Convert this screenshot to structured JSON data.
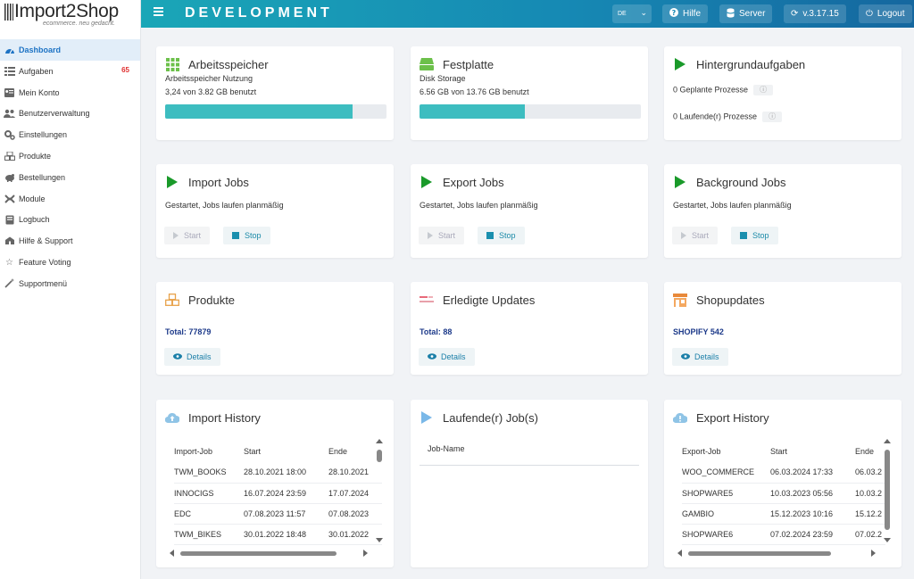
{
  "app": {
    "logo_title": "Import2Shop",
    "logo_subtitle": "ecommerce. neu gedacht.",
    "environment": "DEVELOPMENT"
  },
  "sidebar": {
    "items": [
      {
        "label": "Dashboard",
        "icon": "dashboard-icon",
        "active": true
      },
      {
        "label": "Aufgaben",
        "icon": "tasks-icon",
        "badge": "65"
      },
      {
        "label": "Mein Konto",
        "icon": "account-icon"
      },
      {
        "label": "Benutzerverwaltung",
        "icon": "users-icon"
      },
      {
        "label": "Einstellungen",
        "icon": "settings-icon"
      },
      {
        "label": "Produkte",
        "icon": "products-icon"
      },
      {
        "label": "Bestellungen",
        "icon": "orders-icon"
      },
      {
        "label": "Module",
        "icon": "modules-icon"
      },
      {
        "label": "Logbuch",
        "icon": "logbook-icon"
      },
      {
        "label": "Hilfe & Support",
        "icon": "support-icon"
      },
      {
        "label": "Feature Voting",
        "icon": "star-icon"
      },
      {
        "label": "Supportmenü",
        "icon": "wand-icon"
      }
    ]
  },
  "topbar": {
    "language": "DE",
    "help_label": "Hilfe",
    "server_label": "Server",
    "version_label": "v.3.17.15",
    "logout_label": "Logout"
  },
  "memory": {
    "title": "Arbeitsspeicher",
    "subtitle": "Arbeitsspeicher Nutzung",
    "usage_text": "3,24 von 3.82 GB benutzt",
    "fraction": 0.848
  },
  "disk": {
    "title": "Festplatte",
    "subtitle": "Disk Storage",
    "usage_text": "6.56 GB von 13.76 GB benutzt",
    "fraction": 0.477
  },
  "background_tasks": {
    "title": "Hintergrundaufgaben",
    "planned": "0 Geplante Prozesse",
    "running": "0 Laufende(r) Prozesse"
  },
  "jobs": {
    "status_text": "Gestartet, Jobs laufen planmäßig",
    "start_label": "Start",
    "stop_label": "Stop",
    "import_title": "Import Jobs",
    "export_title": "Export Jobs",
    "background_title": "Background Jobs"
  },
  "products": {
    "title": "Produkte",
    "total": "Total: 77879",
    "details_label": "Details"
  },
  "updates": {
    "title": "Erledigte Updates",
    "total": "Total: 88",
    "details_label": "Details"
  },
  "shopupdates": {
    "title": "Shopupdates",
    "total": "SHOPIFY 542",
    "details_label": "Details"
  },
  "import_history": {
    "title": "Import History",
    "columns": [
      "Import-Job",
      "Start",
      "Ende"
    ],
    "rows": [
      [
        "TWM_BOOKS",
        "28.10.2021 18:00",
        "28.10.2021"
      ],
      [
        "INNOCIGS",
        "16.07.2024 23:59",
        "17.07.2024"
      ],
      [
        "EDC",
        "07.08.2023 11:57",
        "07.08.2023"
      ],
      [
        "TWM_BIKES",
        "30.01.2022 18:48",
        "30.01.2022"
      ]
    ]
  },
  "running_jobs": {
    "title": "Laufende(r) Job(s)",
    "column": "Job-Name"
  },
  "export_history": {
    "title": "Export History",
    "columns": [
      "Export-Job",
      "Start",
      "Ende"
    ],
    "rows": [
      [
        "WOO_COMMERCE",
        "06.03.2024 17:33",
        "06.03.2"
      ],
      [
        "SHOPWARE5",
        "10.03.2023 05:56",
        "10.03.2"
      ],
      [
        "GAMBIO",
        "15.12.2023 10:16",
        "15.12.2"
      ],
      [
        "SHOPWARE6",
        "07.02.2024 23:59",
        "07.02.2"
      ]
    ]
  },
  "colors": {
    "accent": "#1d73c4",
    "topbar_start": "#1aa6b7",
    "topbar_end": "#15679f",
    "progress": "#3dbdc0",
    "badge": "#e03030",
    "play_green": "#1a9a2a"
  }
}
